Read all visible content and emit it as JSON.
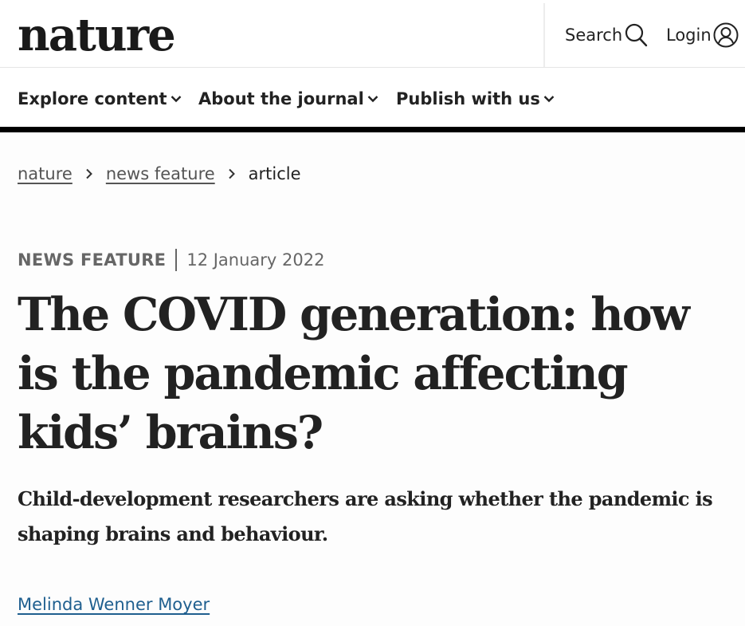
{
  "header": {
    "logo": "nature",
    "search_label": "Search",
    "login_label": "Login"
  },
  "nav": {
    "items": [
      {
        "label": "Explore content",
        "icon": "chevron-down-icon"
      },
      {
        "label": "About the journal",
        "icon": "chevron-down-icon"
      },
      {
        "label": "Publish with us",
        "icon": "chevron-down-icon"
      }
    ]
  },
  "breadcrumb": {
    "items": [
      "nature",
      "news feature"
    ],
    "current": "article"
  },
  "article": {
    "type": "NEWS FEATURE",
    "date": "12 January 2022",
    "title": "The COVID generation: how is the pandemic affecting kids’ brains?",
    "standfirst": "Child-development researchers are asking whether the pandemic is shaping brains and behaviour.",
    "author": "Melinda Wenner Moyer"
  },
  "colors": {
    "nav_border": "#000000",
    "author_link": "#1f5f8f",
    "meta_text": "#666666"
  }
}
